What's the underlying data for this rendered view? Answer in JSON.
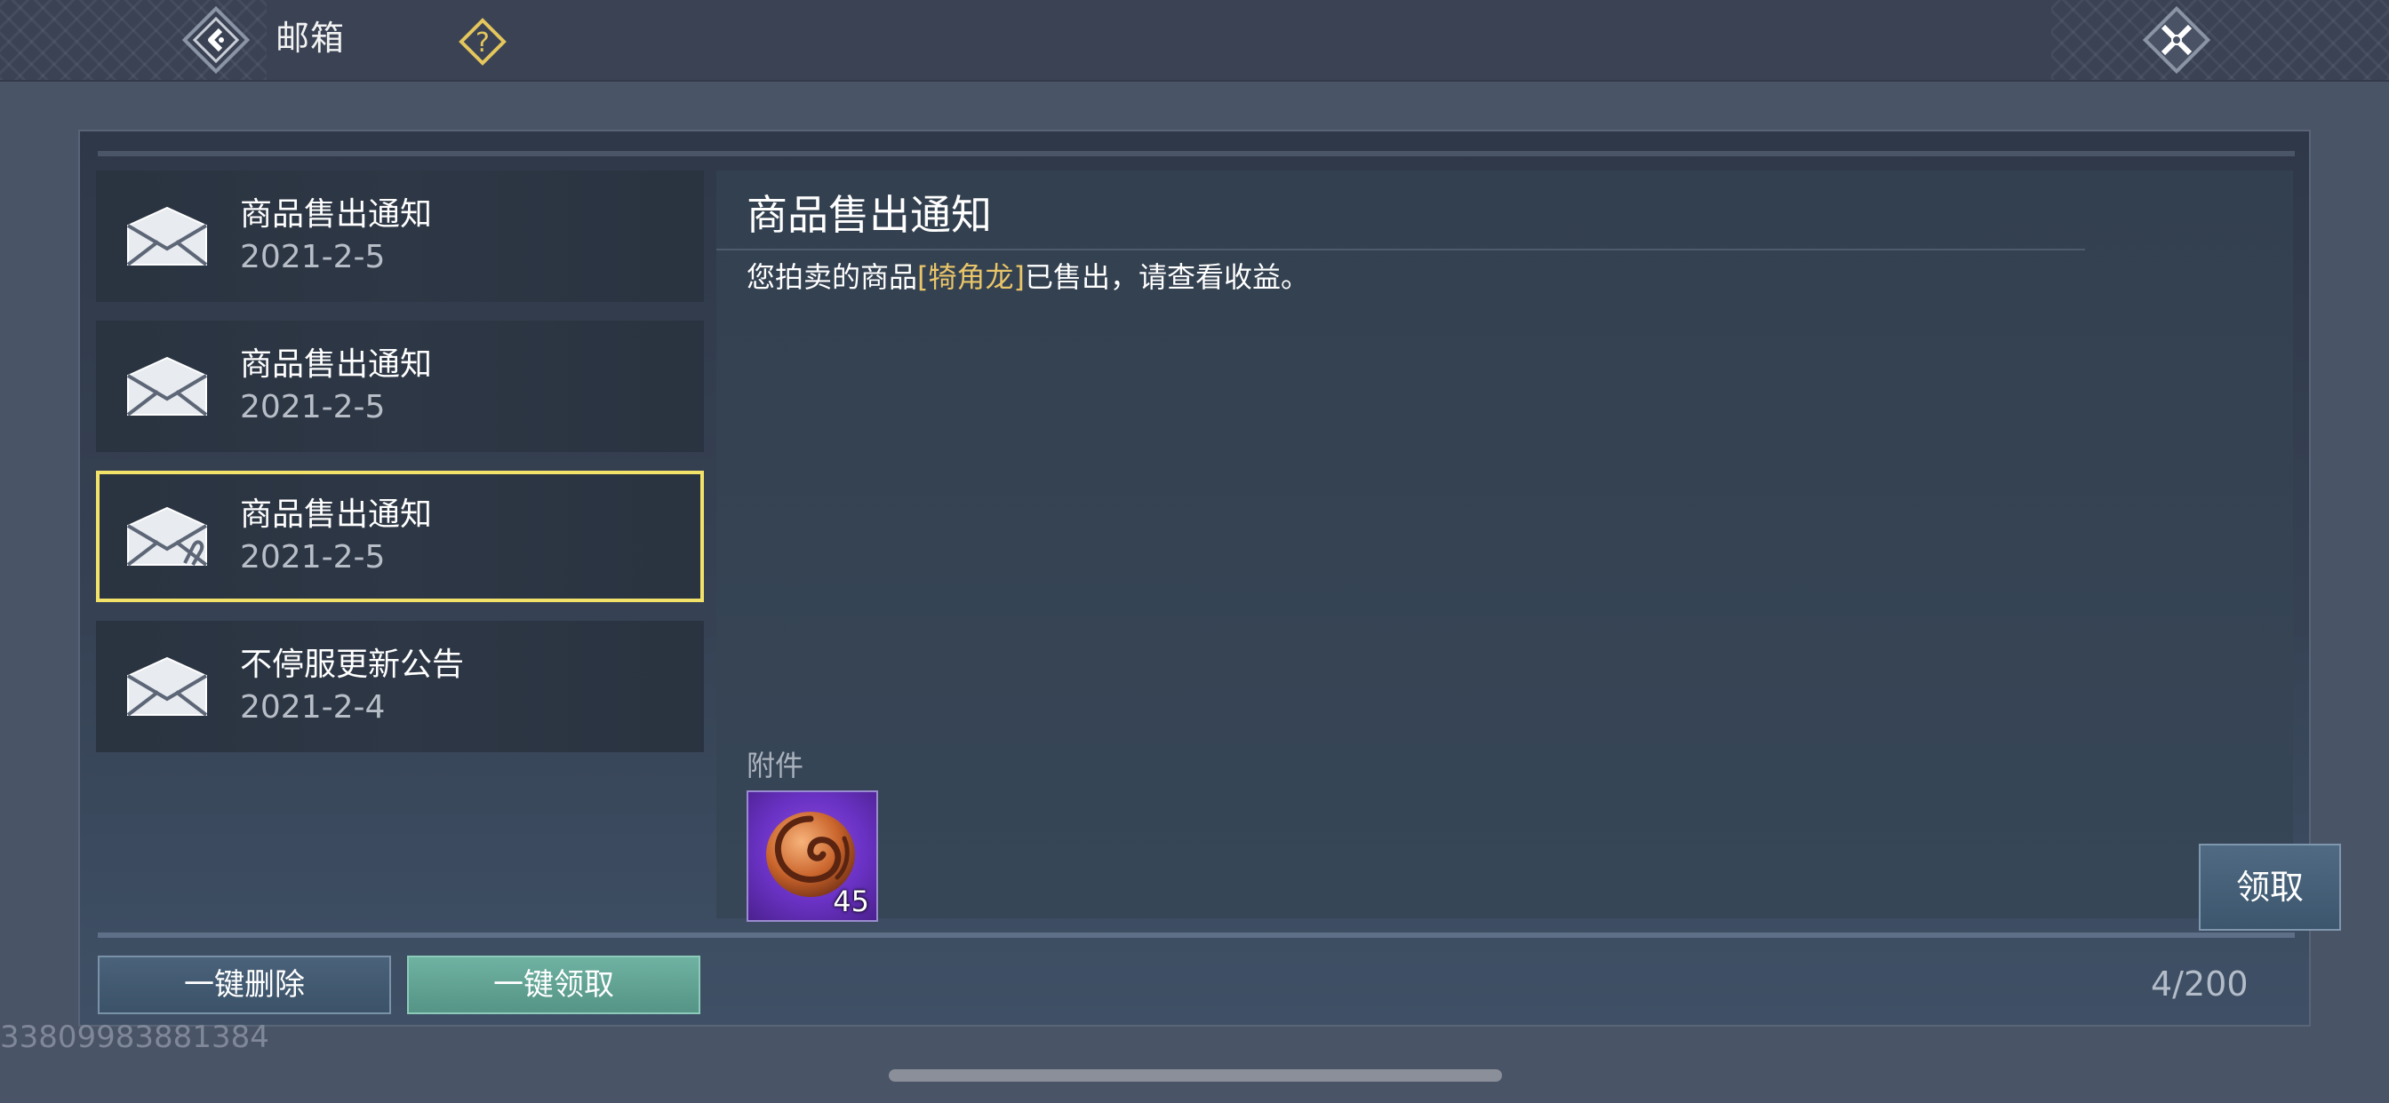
{
  "header": {
    "title": "邮箱",
    "back_icon": "back-arrow-icon",
    "help_icon": "question-mark-icon",
    "close_icon": "close-x-icon"
  },
  "mail_list": [
    {
      "title": "商品售出通知",
      "date": "2021-2-5",
      "selected": false,
      "has_attachment": false
    },
    {
      "title": "商品售出通知",
      "date": "2021-2-5",
      "selected": false,
      "has_attachment": false
    },
    {
      "title": "商品售出通知",
      "date": "2021-2-5",
      "selected": true,
      "has_attachment": true
    },
    {
      "title": "不停服更新公告",
      "date": "2021-2-4",
      "selected": false,
      "has_attachment": false
    }
  ],
  "detail": {
    "title": "商品售出通知",
    "body_prefix": "您拍卖的商品",
    "body_item": "[犄角龙]",
    "body_suffix": "已售出，请查看收益。",
    "attachment_label": "附件",
    "attachment": {
      "icon": "swirl-coin-icon",
      "count": "45"
    },
    "claim_button": "领取"
  },
  "footer": {
    "delete_all_button": "一键删除",
    "claim_all_button": "一键领取",
    "mail_count": "4/200"
  },
  "uid": "33809983881384",
  "colors": {
    "selected_border": "#f3e26a",
    "highlight_text": "#e9c56a",
    "claim_all_button": "#6fb2a2",
    "attachment_bg": "#6a32c4"
  }
}
